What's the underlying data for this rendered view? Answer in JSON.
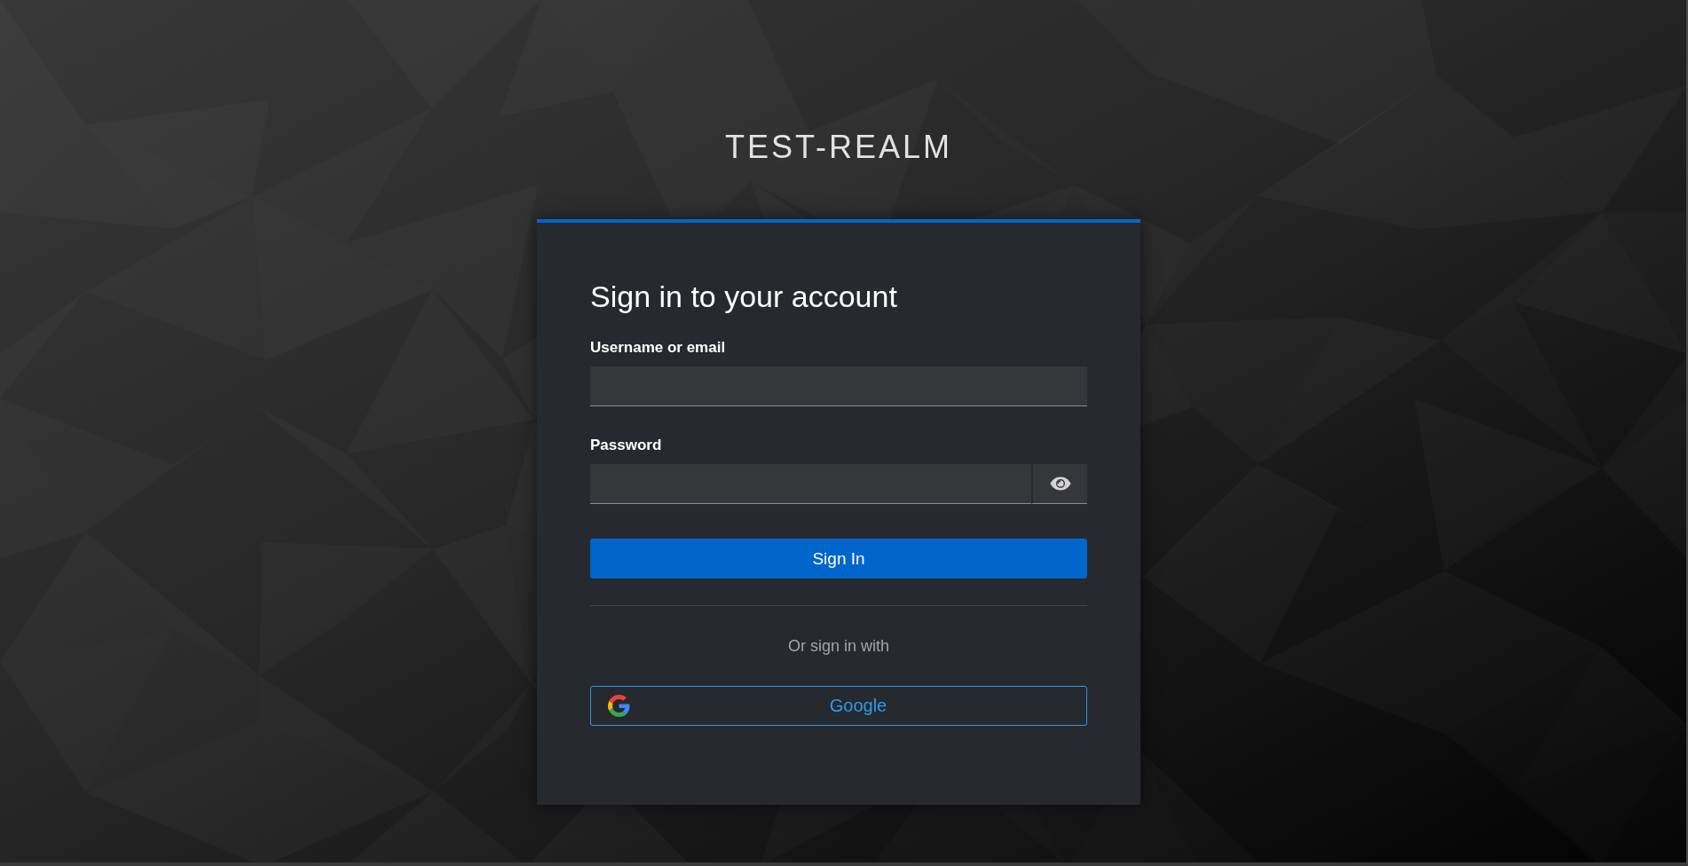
{
  "realm_title": "TEST-REALM",
  "login_card": {
    "heading": "Sign in to your account",
    "fields": [
      {
        "label": "Username or email",
        "kind": "text"
      },
      {
        "label": "Password",
        "kind": "password"
      }
    ],
    "submit_button": "Sign In",
    "social_divider": "Or sign in with",
    "social_providers": [
      {
        "label": "Google",
        "kind": "google"
      }
    ]
  }
}
